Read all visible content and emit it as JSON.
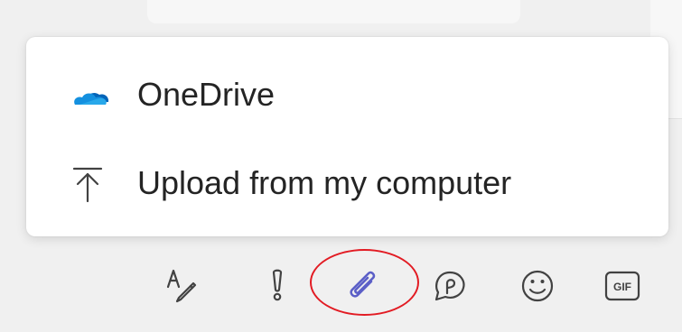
{
  "attach_menu": {
    "items": [
      {
        "label": "OneDrive",
        "icon": "onedrive-cloud-icon"
      },
      {
        "label": "Upload from my computer",
        "icon": "upload-arrow-icon"
      }
    ]
  },
  "toolbar": {
    "buttons": [
      {
        "name": "format-button",
        "icon": "format-pen-icon"
      },
      {
        "name": "important-button",
        "icon": "exclamation-icon"
      },
      {
        "name": "attach-file-button",
        "icon": "paperclip-icon",
        "state": "active"
      },
      {
        "name": "loop-button",
        "icon": "loop-icon"
      },
      {
        "name": "emoji-button",
        "icon": "smiley-icon"
      },
      {
        "name": "gif-button",
        "icon": "gif-icon",
        "label": "GIF"
      }
    ]
  },
  "annotation": {
    "type": "highlight-circle",
    "target": "attach-file-button",
    "color": "#e21b23"
  },
  "colors": {
    "onedrive_blue": "#0f78d4",
    "active_icon": "#5b5fc7",
    "icon_default": "#424242",
    "text": "#242424",
    "menu_bg": "#ffffff",
    "page_bg": "#f0f0f0"
  }
}
